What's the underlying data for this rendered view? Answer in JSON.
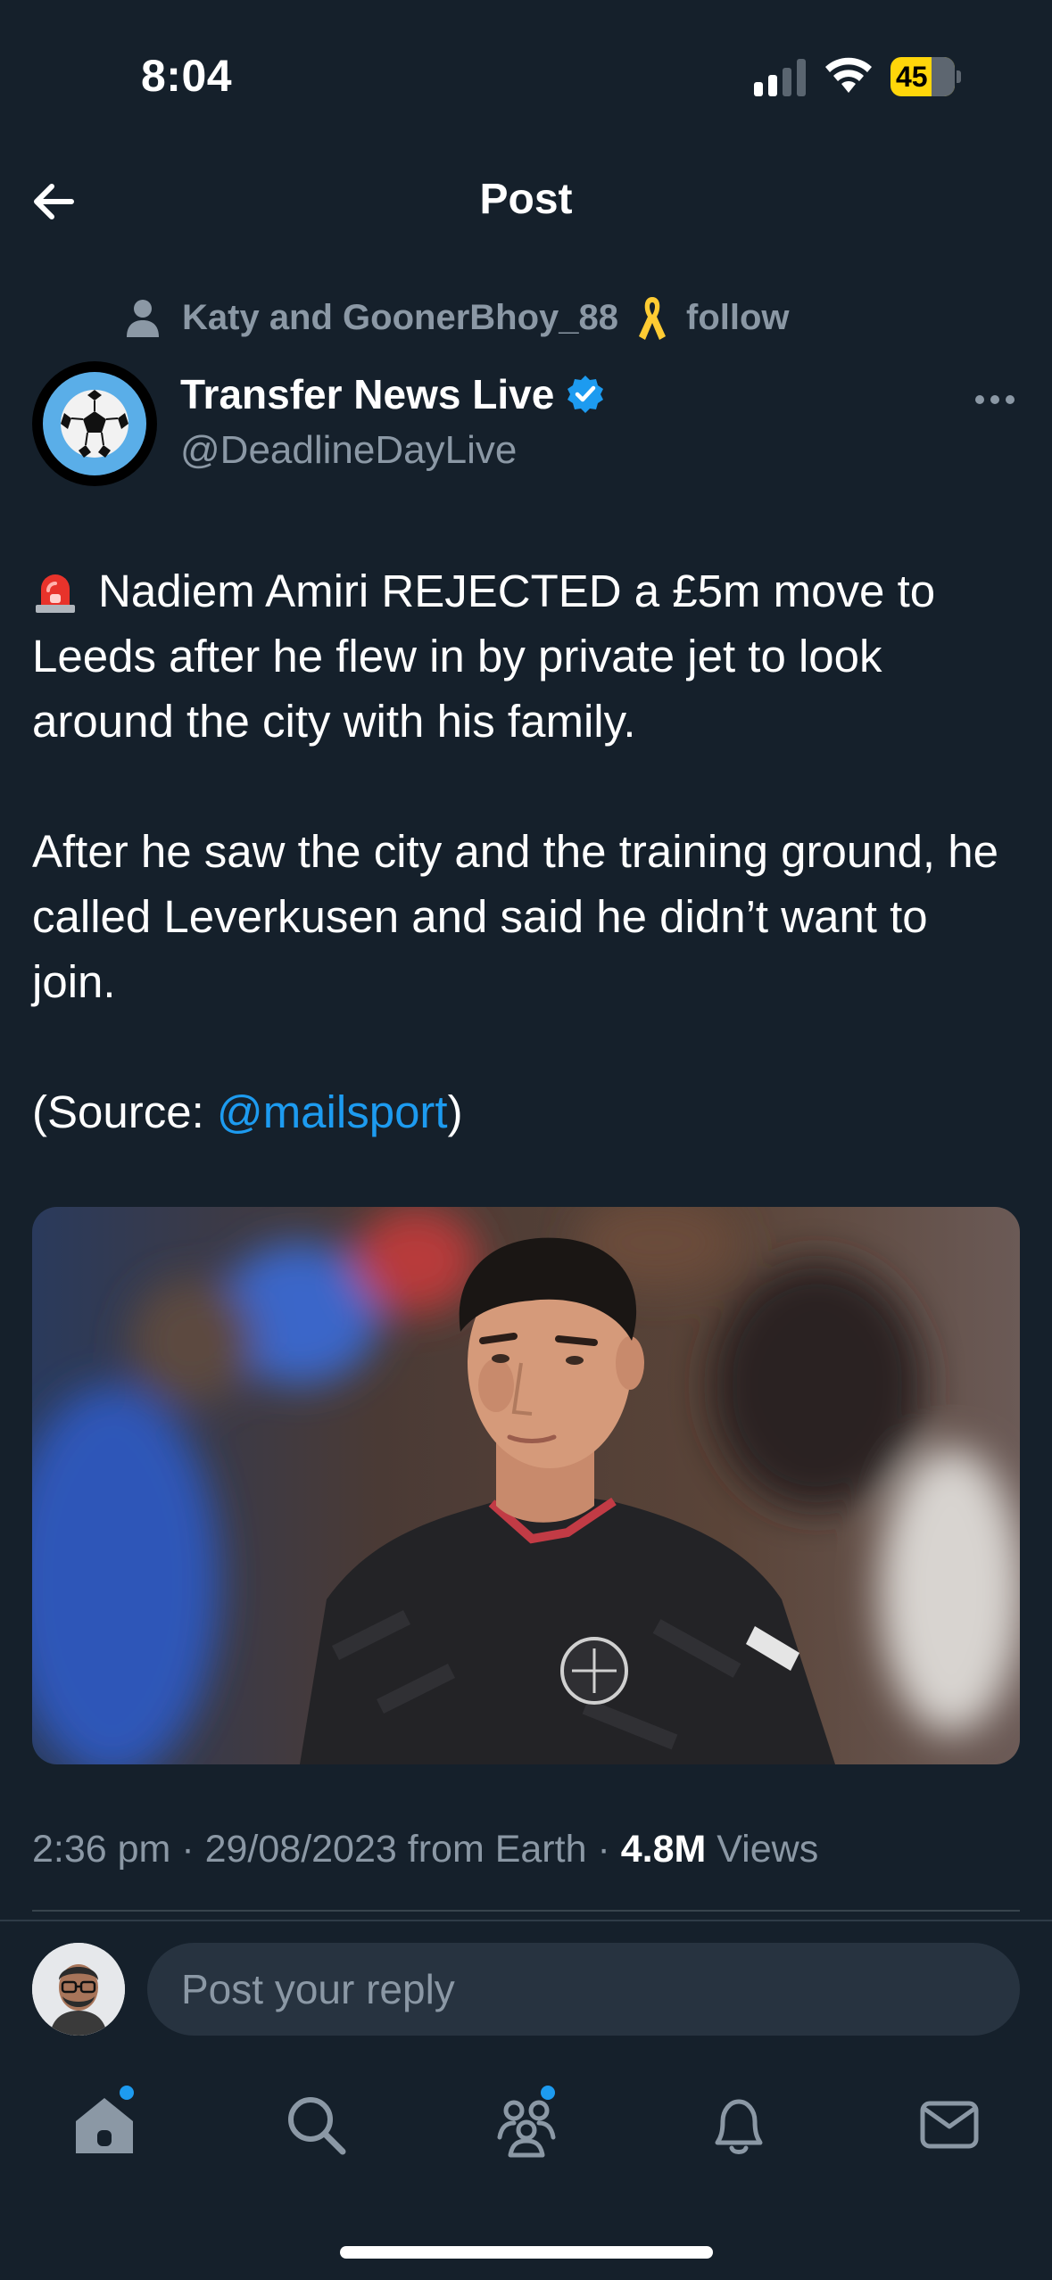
{
  "status_bar": {
    "time": "8:04",
    "battery_level": "45",
    "battery_charging": true,
    "signal_bars_active": 2,
    "signal_bars_total": 4
  },
  "header": {
    "title": "Post",
    "back_icon": "arrow-left-icon"
  },
  "social_context": {
    "text": "Katy and GoonerBhoy_88",
    "follow_text": "follow"
  },
  "author": {
    "name": "Transfer News Live",
    "handle": "@DeadlineDayLive",
    "verified": true
  },
  "tweet": {
    "paragraph1": "Nadiem Amiri REJECTED a £5m move to Leeds after he flew in by private jet to look around the city with his family.",
    "paragraph2": "After he saw the city and the training ground, he called Leverkusen and said he didn’t want to join.",
    "source_prefix": "(Source: ",
    "source_mention": "@mailsport",
    "source_suffix": ")"
  },
  "meta": {
    "time": "2:36 pm",
    "date": "29/08/2023",
    "origin": "from Earth",
    "views_count": "4.8M",
    "views_label": "Views"
  },
  "reply": {
    "placeholder": "Post your reply"
  },
  "tab_bar": {
    "items": [
      "home-icon",
      "search-icon",
      "communities-icon",
      "notifications-icon",
      "messages-icon"
    ]
  },
  "colors": {
    "background": "#15202b",
    "accent": "#1d9bf0",
    "secondary_text": "#8b98a5"
  }
}
